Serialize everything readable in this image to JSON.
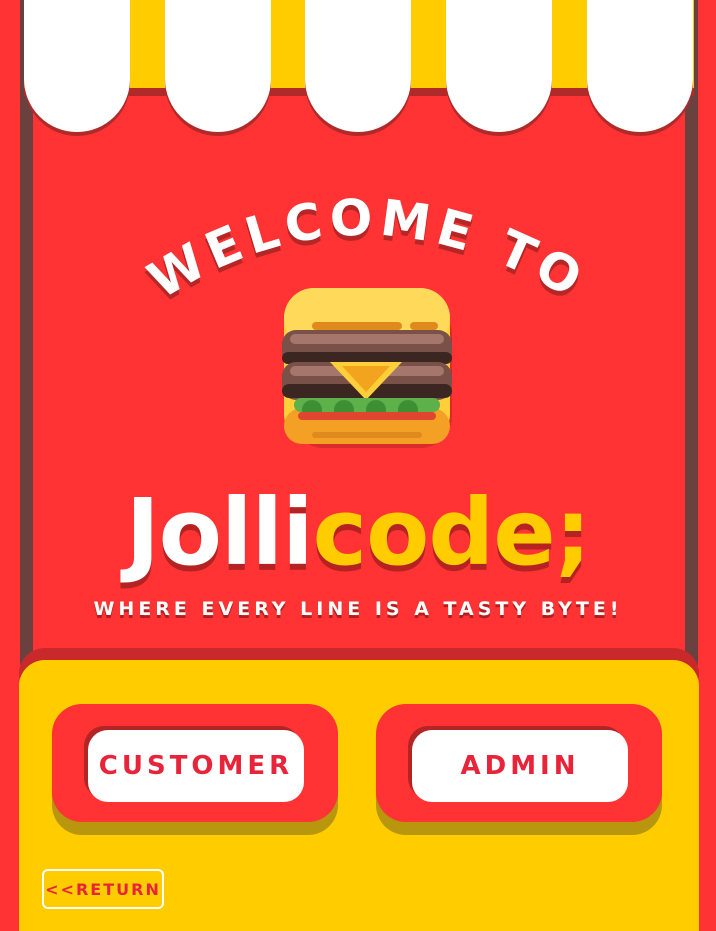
{
  "header": {
    "welcome_text": "WELCOME TO"
  },
  "brand": {
    "name_part1": "Jolli",
    "name_part2": "code;",
    "tagline": "WHERE EVERY LINE IS A TASTY BYTE!"
  },
  "roles": {
    "customer_label": "CUSTOMER",
    "admin_label": "ADMIN"
  },
  "nav": {
    "return_label": "<<RETURN"
  },
  "colors": {
    "background_red": "#ff3333",
    "accent_yellow": "#ffcc00",
    "button_text_red": "#e8243a",
    "awning_white": "#ffffff",
    "post_brown": "#6b4140"
  },
  "icons": {
    "logo": "burger-icon"
  }
}
